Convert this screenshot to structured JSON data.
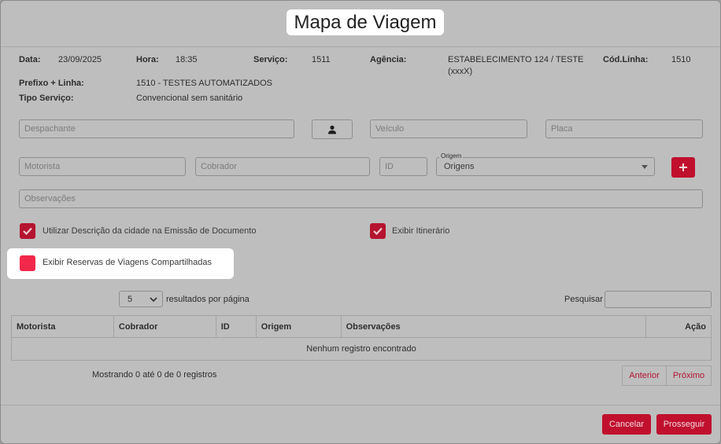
{
  "modal": {
    "title": "Mapa de Viagem"
  },
  "info": {
    "data_label": "Data:",
    "data_value": "23/09/2025",
    "hora_label": "Hora:",
    "hora_value": "18:35",
    "servico_label": "Serviço:",
    "servico_value": "1511",
    "agencia_label": "Agência:",
    "agencia_value_line1": "ESTABELECIMENTO 124 / TESTE",
    "agencia_value_line2": "(xxxX)",
    "codlinha_label": "Cód.Linha:",
    "codlinha_value": "1510",
    "prefixo_label": "Prefixo + Linha:",
    "prefixo_value": "1510 - TESTES AUTOMATIZADOS",
    "tipo_label": "Tipo Serviço:",
    "tipo_value": "Convencional sem sanitário"
  },
  "form": {
    "despachante_placeholder": "Despachante",
    "veiculo_placeholder": "Veículo",
    "placa_placeholder": "Placa",
    "motorista_placeholder": "Motorista",
    "cobrador_placeholder": "Cobrador",
    "id_placeholder": "ID",
    "origem_label": "Origem",
    "origem_selected": "Origens",
    "observacoes_placeholder": "Observações",
    "add_icon": "plus-icon",
    "person_icon": "person-icon"
  },
  "checkboxes": {
    "utilizar_descricao": {
      "label": "Utilizar Descrição da cidade na Emissão de Documento",
      "checked": true
    },
    "exibir_itinerario": {
      "label": "Exibir Itinerário",
      "checked": true
    },
    "exibir_reservas": {
      "label": "Exibir Reservas de Viagens Compartilhadas",
      "checked": false
    }
  },
  "table": {
    "page_size": "5",
    "page_size_suffix": "resultados por página",
    "search_label": "Pesquisar",
    "columns": [
      "Motorista",
      "Cobrador",
      "ID",
      "Origem",
      "Observações",
      "Ação"
    ],
    "empty_text": "Nenhum registro encontrado",
    "info_text": "Mostrando 0 até 0 de 0 registros",
    "prev_label": "Anterior",
    "next_label": "Próximo"
  },
  "footer": {
    "cancel_label": "Cancelar",
    "proceed_label": "Prosseguir"
  },
  "colors": {
    "accent": "#c0102e",
    "checkbox_unchecked_highlight": "#f2284a",
    "backdrop": "#bebebe"
  }
}
